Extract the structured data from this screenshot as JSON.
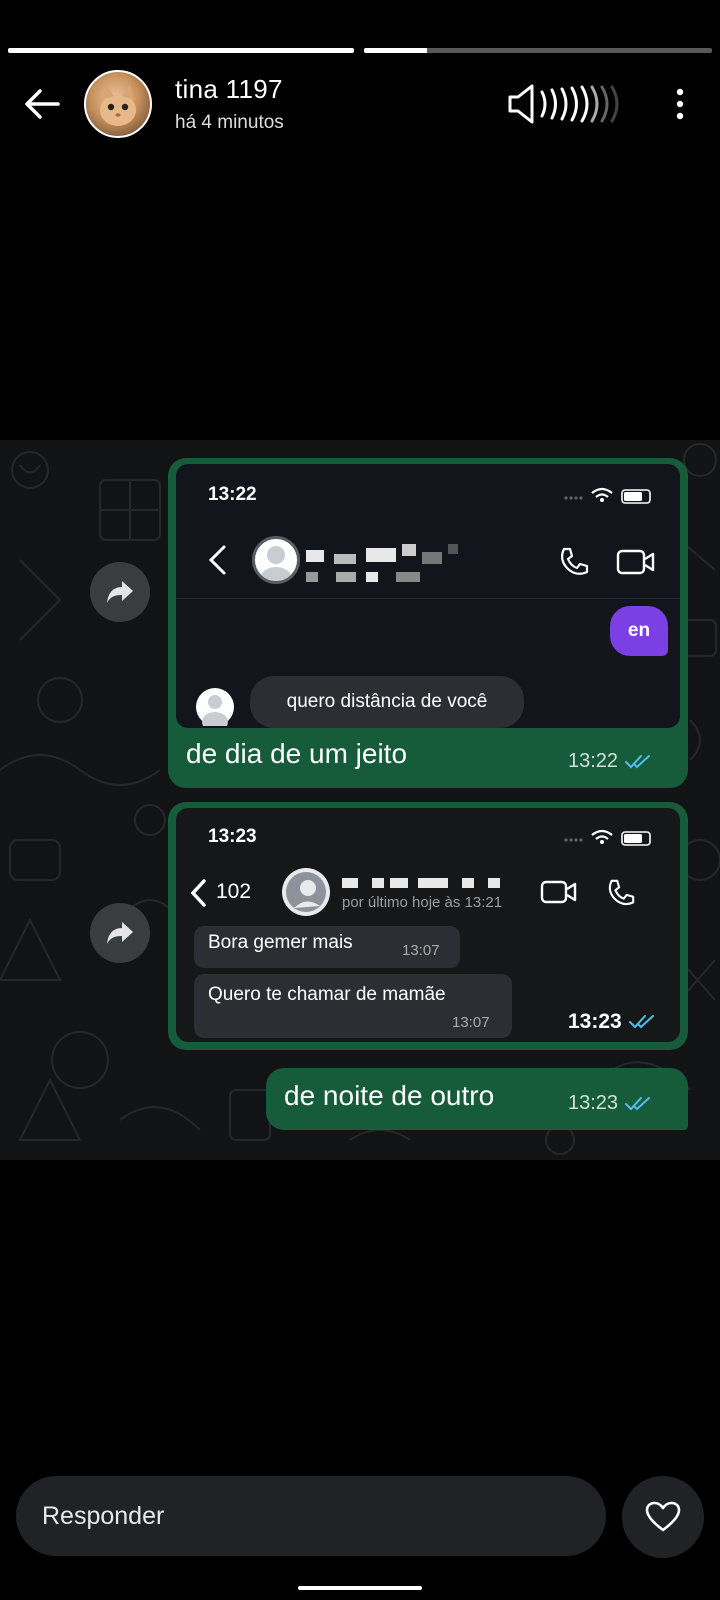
{
  "story": {
    "progress": [
      1.0,
      0.18
    ],
    "user_name": "tina 1197",
    "time_ago": "há 4 minutos"
  },
  "icons": {
    "back": "arrow-left-icon",
    "sound": "speaker-icon",
    "more": "more-vertical-icon",
    "forward": "forward-icon",
    "heart": "heart-icon"
  },
  "shot1": {
    "status_time": "13:22",
    "sent_text": "en",
    "received_text": "quero distância de você"
  },
  "bubble1": {
    "text": "de dia de um jeito",
    "time": "13:22"
  },
  "shot2": {
    "status_time": "13:23",
    "back_count": "102",
    "last_seen": "por último hoje às 13:21",
    "messages": [
      {
        "text": "Bora gemer mais",
        "time": "13:07"
      },
      {
        "text": "Quero te chamar de mamãe",
        "time": "13:07"
      }
    ]
  },
  "bubble2": {
    "time": "13:23"
  },
  "bubble3": {
    "text": "de noite de outro",
    "time": "13:23"
  },
  "reply": {
    "placeholder": "Responder"
  },
  "colors": {
    "bubble_green": "#165c3b",
    "tick_blue": "#53bdeb",
    "sent_purple": "#7b3fe4"
  }
}
